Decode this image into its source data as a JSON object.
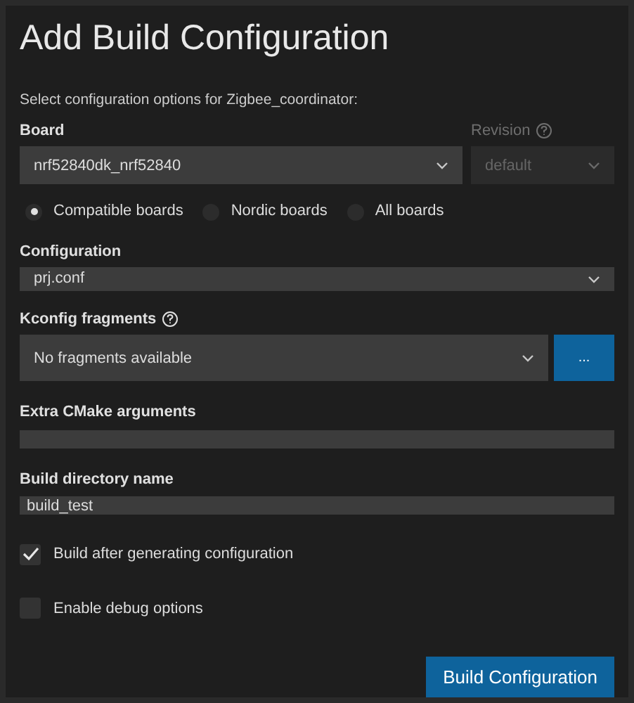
{
  "title": "Add Build Configuration",
  "subtitle": "Select configuration options for Zigbee_coordinator:",
  "board": {
    "label": "Board",
    "value": "nrf52840dk_nrf52840"
  },
  "revision": {
    "label": "Revision",
    "value": "default",
    "disabled": true
  },
  "board_filters": [
    {
      "label": "Compatible boards",
      "selected": true
    },
    {
      "label": "Nordic boards",
      "selected": false
    },
    {
      "label": "All boards",
      "selected": false
    }
  ],
  "configuration": {
    "label": "Configuration",
    "value": "prj.conf"
  },
  "kconfig": {
    "label": "Kconfig fragments",
    "value": "No fragments available",
    "button": "..."
  },
  "cmake_args": {
    "label": "Extra CMake arguments"
  },
  "build_dir": {
    "label": "Build directory name",
    "value": "build_test"
  },
  "options": [
    {
      "label": "Build after generating configuration",
      "checked": true
    },
    {
      "label": "Enable debug options",
      "checked": false
    }
  ],
  "submit": "Build Configuration"
}
